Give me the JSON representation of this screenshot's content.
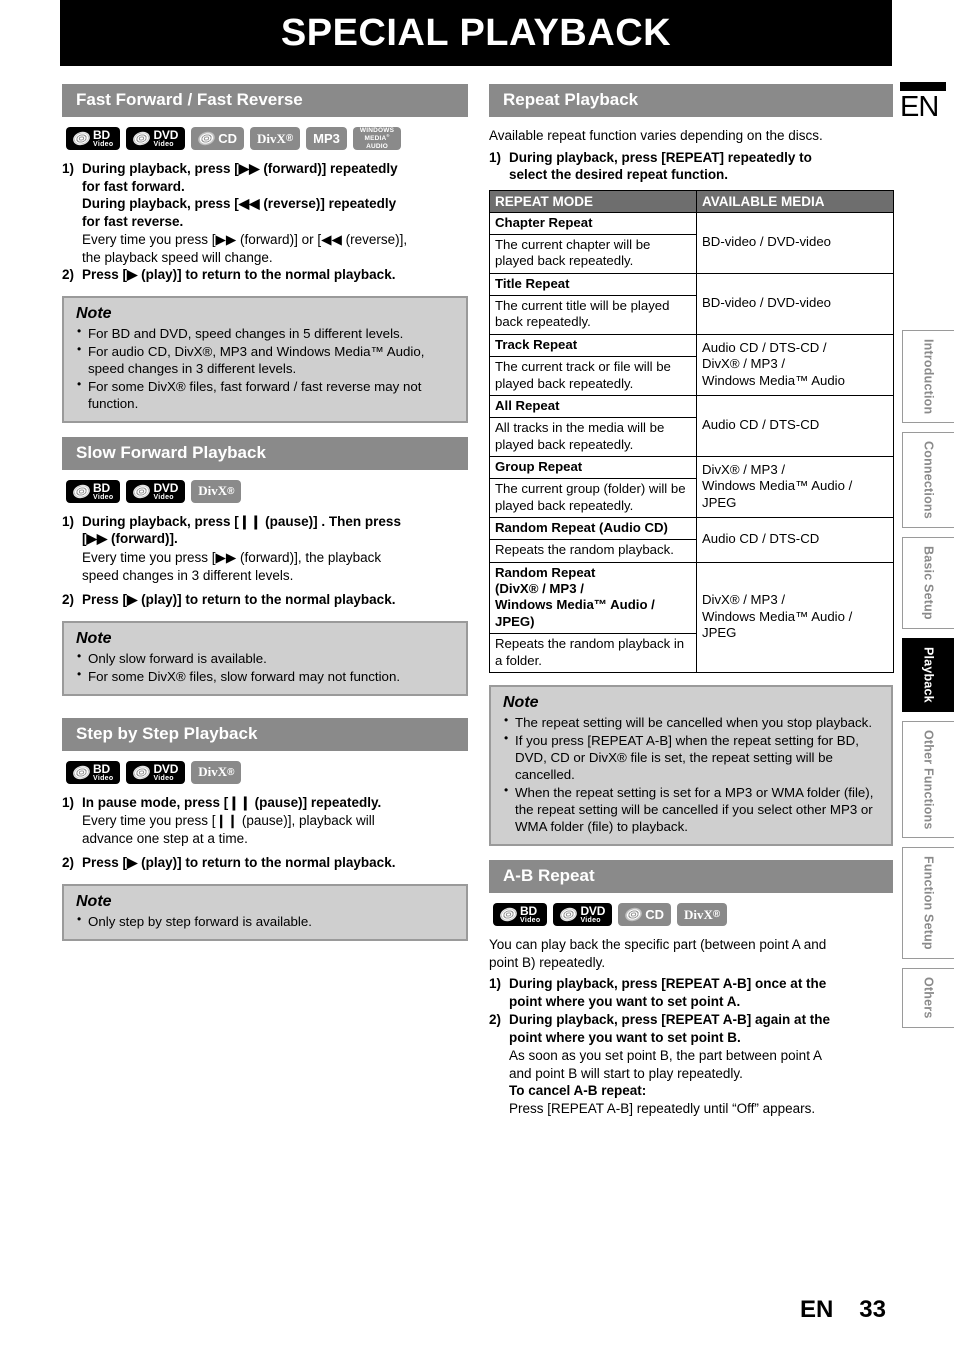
{
  "page": {
    "title": "SPECIAL PLAYBACK",
    "lang_flag": "EN",
    "footer_lang": "EN",
    "footer_page": "33"
  },
  "side_tabs": [
    {
      "label": "Introduction",
      "active": false
    },
    {
      "label": "Connections",
      "active": false
    },
    {
      "label": "Basic Setup",
      "active": false
    },
    {
      "label": "Playback",
      "active": true
    },
    {
      "label": "Other Functions",
      "active": false
    },
    {
      "label": "Function Setup",
      "active": false
    },
    {
      "label": "Others",
      "active": false
    }
  ],
  "badge_labels": {
    "bd_big": "BD",
    "bd_small": "Video",
    "dvd_big": "DVD",
    "dvd_small": "Video",
    "cd": "CD",
    "divx": "DivX",
    "mp3": "MP3",
    "wma_l1": "WINDOWS",
    "wma_l2": "MEDIA",
    "wma_l3": "AUDIO"
  },
  "sections": {
    "fast_forward": {
      "heading": "Fast Forward / Fast Reverse",
      "step1_num": "1)",
      "step1_line1": "During playback, press [▶▶ (forward)] repeatedly",
      "step1_line2": "for fast forward.",
      "step1_line3": "During playback, press [◀◀ (reverse)] repeatedly",
      "step1_line4": "for fast reverse.",
      "step1_sub1": "Every time you press [▶▶ (forward)] or [◀◀ (reverse)],",
      "step1_sub2": "the playback speed will change.",
      "step2_num": "2)",
      "step2_text": "Press [▶ (play)] to return to the normal playback.",
      "note_heading": "Note",
      "note_items": [
        "For BD and DVD, speed changes in 5 different levels.",
        "For audio CD, DivX®, MP3 and Windows Media™ Audio, speed changes in 3 different levels.",
        "For some DivX® files, fast forward / fast reverse may not function."
      ]
    },
    "slow_forward": {
      "heading": "Slow Forward Playback",
      "step1_num": "1)",
      "step1_line1": "During playback, press [❙❙ (pause)] . Then press",
      "step1_line2": "[▶▶ (forward)].",
      "step1_sub1": "Every time you press [▶▶ (forward)], the playback",
      "step1_sub2": "speed changes in 3 different levels.",
      "step2_num": "2)",
      "step2_text": "Press [▶ (play)] to return to the normal playback.",
      "note_heading": "Note",
      "note_items": [
        "Only slow forward is available.",
        "For some DivX® files, slow forward may not function."
      ]
    },
    "step_by_step": {
      "heading": "Step by Step Playback",
      "step1_num": "1)",
      "step1_line1": "In pause mode, press [❙❙ (pause)] repeatedly.",
      "step1_sub1": "Every time you press [❙❙ (pause)], playback will",
      "step1_sub2": "advance one step at a time.",
      "step2_num": "2)",
      "step2_text": "Press [▶ (play)] to return to the normal playback.",
      "note_heading": "Note",
      "note_items": [
        "Only step by step forward is available."
      ]
    },
    "repeat_playback": {
      "heading": "Repeat Playback",
      "intro": "Available repeat function varies depending on the discs.",
      "step1_num": "1)",
      "step1_line1": "During playback, press [REPEAT] repeatedly to",
      "step1_line2": "select the desired repeat function.",
      "table": {
        "col_headers": [
          "REPEAT MODE",
          "AVAILABLE MEDIA"
        ],
        "rows": [
          {
            "mode": "Chapter Repeat",
            "desc": "The current chapter will be played back repeatedly.",
            "media": "BD-video / DVD-video"
          },
          {
            "mode": "Title Repeat",
            "desc": "The current title will be played back repeatedly.",
            "media": "BD-video / DVD-video"
          },
          {
            "mode": "Track Repeat",
            "desc": "The current track or file will be played back repeatedly.",
            "media": "Audio CD / DTS-CD /\nDivX® / MP3 /\nWindows Media™ Audio"
          },
          {
            "mode": "All Repeat",
            "desc": "All tracks in the media will be played back repeatedly.",
            "media": "Audio CD / DTS-CD"
          },
          {
            "mode": "Group Repeat",
            "desc": "The current group (folder) will be played back repeatedly.",
            "media": "DivX® / MP3 /\nWindows Media™ Audio /\nJPEG"
          },
          {
            "mode": "Random Repeat (Audio CD)",
            "desc": "Repeats the random playback.",
            "media": "Audio CD / DTS-CD"
          },
          {
            "mode": "Random Repeat\n(DivX® / MP3 /\nWindows Media™ Audio /\nJPEG)",
            "desc": "Repeats the random playback in a folder.",
            "media": "DivX® / MP3 /\nWindows Media™ Audio /\nJPEG"
          }
        ]
      },
      "note_heading": "Note",
      "note_items": [
        "The repeat setting will be cancelled when you stop playback.",
        "If you press [REPEAT A-B] when the repeat setting for BD, DVD, CD or DivX® file is set, the repeat setting will be cancelled.",
        "When the repeat setting is set for a MP3 or WMA folder (file), the repeat setting will be cancelled if you select other MP3 or WMA folder (file) to playback."
      ]
    },
    "ab_repeat": {
      "heading": "A-B Repeat",
      "intro1": "You can play back the specific part (between point A and",
      "intro2": "point B) repeatedly.",
      "step1_num": "1)",
      "step1_line1": "During playback, press [REPEAT A-B] once at the",
      "step1_line2": "point where you want to set point A.",
      "step2_num": "2)",
      "step2_line1": "During playback, press [REPEAT A-B] again at the",
      "step2_line2": "point where you want to set point B.",
      "step2_sub1": "As soon as you set point B, the part between point A",
      "step2_sub2": "and point B will start to play repeatedly.",
      "cancel_heading": "To cancel A-B repeat:",
      "cancel_text": "Press [REPEAT A-B] repeatedly until “Off” appears."
    }
  }
}
